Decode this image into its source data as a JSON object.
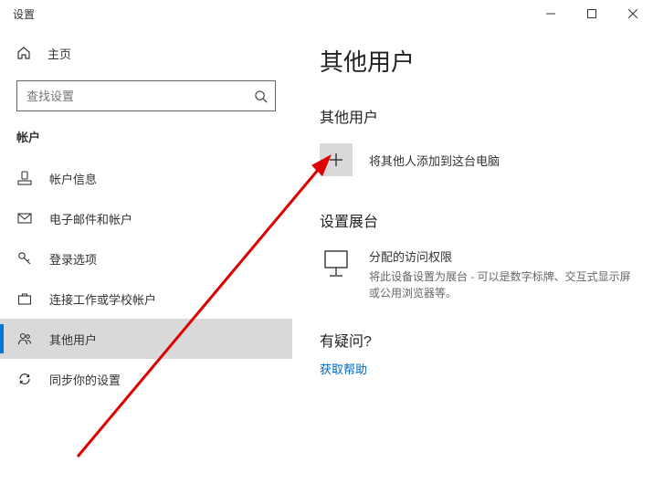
{
  "window": {
    "title": "设置"
  },
  "sidebar": {
    "home": "主页",
    "search_placeholder": "查找设置",
    "section": "帐户",
    "items": [
      {
        "label": "帐户信息"
      },
      {
        "label": "电子邮件和帐户"
      },
      {
        "label": "登录选项"
      },
      {
        "label": "连接工作或学校帐户"
      },
      {
        "label": "其他用户"
      },
      {
        "label": "同步你的设置"
      }
    ]
  },
  "content": {
    "title": "其他用户",
    "other_users_heading": "其他用户",
    "add_label": "将其他人添加到这台电脑",
    "kiosk_heading": "设置展台",
    "kiosk_title": "分配的访问权限",
    "kiosk_desc": "将此设备设置为展台 - 可以是数字标牌、交互式显示屏或公用浏览器等。",
    "help_heading": "有疑问?",
    "help_link": "获取帮助"
  }
}
